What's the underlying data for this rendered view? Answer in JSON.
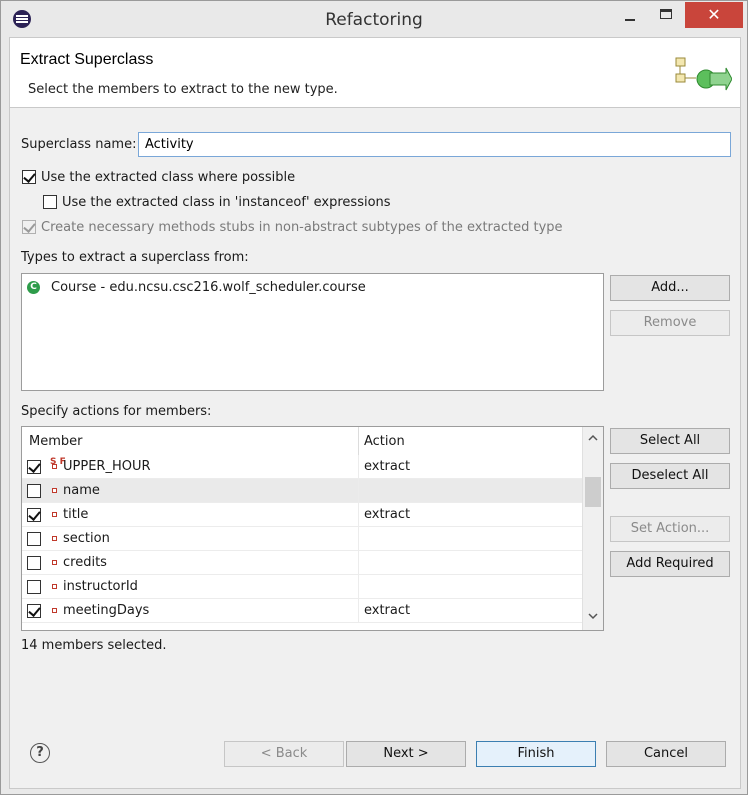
{
  "window": {
    "title": "Refactoring",
    "close_glyph": "✕"
  },
  "header": {
    "title": "Extract Superclass",
    "description": "Select the members to extract to the new type."
  },
  "superclass": {
    "label": "Superclass name:",
    "value": "Activity"
  },
  "options": {
    "use_extracted": {
      "label": "Use the extracted class where possible",
      "checked": true
    },
    "use_instanceof": {
      "label": "Use the extracted class in 'instanceof' expressions",
      "checked": false
    },
    "create_stubs": {
      "label": "Create necessary methods stubs in non-abstract subtypes of the extracted type",
      "checked": true,
      "disabled": true
    }
  },
  "types": {
    "label": "Types to extract a superclass from:",
    "items": [
      {
        "icon": "class-icon",
        "icon_glyph": "C",
        "label": "Course - edu.ncsu.csc216.wolf_scheduler.course"
      }
    ],
    "add_button": "Add...",
    "remove_button": "Remove"
  },
  "members": {
    "label": "Specify actions for members:",
    "columns": [
      "Member",
      "Action"
    ],
    "rows": [
      {
        "name": "UPPER_HOUR",
        "action": "extract",
        "checked": true,
        "icon": "static-final-field-icon",
        "icon_glyph": "S F"
      },
      {
        "name": "name",
        "action": "",
        "checked": false,
        "icon": "private-field-icon",
        "selected": true
      },
      {
        "name": "title",
        "action": "extract",
        "checked": true,
        "icon": "private-field-icon"
      },
      {
        "name": "section",
        "action": "",
        "checked": false,
        "icon": "private-field-icon"
      },
      {
        "name": "credits",
        "action": "",
        "checked": false,
        "icon": "private-field-icon"
      },
      {
        "name": "instructorId",
        "action": "",
        "checked": false,
        "icon": "private-field-icon"
      },
      {
        "name": "meetingDays",
        "action": "extract",
        "checked": true,
        "icon": "private-field-icon"
      }
    ],
    "select_all": "Select All",
    "deselect_all": "Deselect All",
    "set_action": "Set Action...",
    "add_required": "Add Required",
    "status": "14 members selected."
  },
  "footer": {
    "help_glyph": "?",
    "back": "< Back",
    "next": "Next >",
    "finish": "Finish",
    "cancel": "Cancel"
  },
  "colors": {
    "accent": "#3c7fb1",
    "close": "#c9453b",
    "field_icon": "#c0392b",
    "class_icon": "#2e9c4a"
  }
}
